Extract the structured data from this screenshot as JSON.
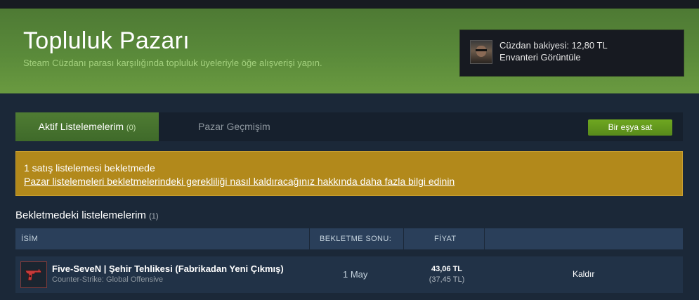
{
  "banner": {
    "title": "Topluluk Pazarı",
    "subtitle": "Steam Cüzdanı parası karşılığında topluluk üyeleriyle öğe alışverişi yapın."
  },
  "wallet": {
    "balance": "Cüzdan bakiyesi: 12,80 TL",
    "inventory_link": "Envanteri Görüntüle"
  },
  "tabs": {
    "active_label": "Aktif Listelemelerim",
    "active_count": "(0)",
    "history_label": "Pazar Geçmişim"
  },
  "sell_button": "Bir eşya sat",
  "notice": {
    "text": "1 satış listelemesi bekletmede",
    "link": "Pazar listelemeleri bekletmelerindeki gerekliliği nasıl kaldıracağınız hakkında daha fazla bilgi edinin"
  },
  "section": {
    "title": "Bekletmedeki listelemelerim",
    "count": "(1)"
  },
  "table": {
    "headers": [
      "İSİM",
      "BEKLETME SONU:",
      "FİYAT"
    ],
    "rows": [
      {
        "name": "Five-SeveN | Şehir Tehlikesi (Fabrikadan Yeni Çıkmış)",
        "game": "Counter-Strike: Global Offensive",
        "hold_end": "1 May",
        "price": "43,06 TL",
        "price_sub": "(37,45 TL)",
        "action": "Kaldır"
      }
    ]
  },
  "colors": {
    "page_bg": "#1b2838",
    "banner_green": "#5a8a3a",
    "notice_gold": "#b2891b",
    "button_green": "#6fa720"
  }
}
